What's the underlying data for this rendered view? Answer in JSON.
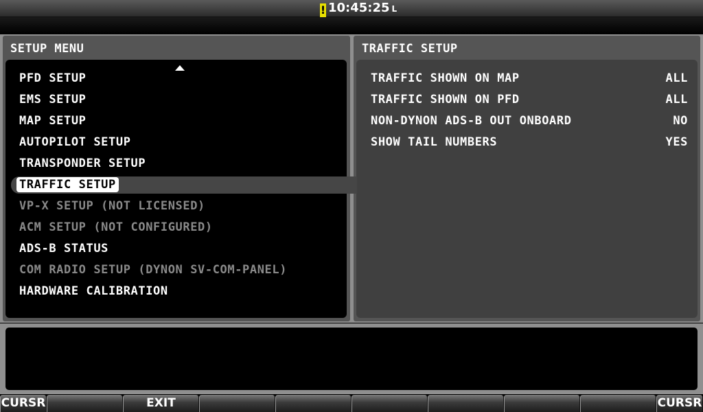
{
  "status": {
    "clock": "10:45:25",
    "clock_suffix": "L",
    "alert": "!"
  },
  "setup_menu": {
    "title": "SETUP MENU",
    "items": [
      {
        "label": "PFD SETUP",
        "state": "enabled"
      },
      {
        "label": "EMS SETUP",
        "state": "enabled"
      },
      {
        "label": "MAP SETUP",
        "state": "enabled"
      },
      {
        "label": "AUTOPILOT SETUP",
        "state": "enabled"
      },
      {
        "label": "TRANSPONDER SETUP",
        "state": "enabled"
      },
      {
        "label": "TRAFFIC SETUP",
        "state": "selected"
      },
      {
        "label": "VP-X SETUP (NOT LICENSED)",
        "state": "disabled"
      },
      {
        "label": "ACM SETUP (NOT CONFIGURED)",
        "state": "disabled"
      },
      {
        "label": "ADS-B STATUS",
        "state": "enabled"
      },
      {
        "label": "COM RADIO SETUP (DYNON SV-COM-PANEL)",
        "state": "disabled"
      },
      {
        "label": "HARDWARE CALIBRATION",
        "state": "enabled"
      }
    ]
  },
  "traffic_setup": {
    "title": "TRAFFIC SETUP",
    "rows": [
      {
        "label": "TRAFFIC SHOWN ON MAP",
        "value": "ALL"
      },
      {
        "label": "TRAFFIC SHOWN ON PFD",
        "value": "ALL"
      },
      {
        "label": "NON-DYNON ADS-B OUT ONBOARD",
        "value": "NO"
      },
      {
        "label": "SHOW TAIL NUMBERS",
        "value": "YES"
      }
    ]
  },
  "softkeys": [
    "CURSR",
    "",
    "EXIT",
    "",
    "",
    "",
    "",
    "",
    "CURSR"
  ],
  "colors": {
    "alert": "#e8e000",
    "disabled_text": "#8a8a8a",
    "selected_bg": "#ffffff",
    "frame": "#8f8f8f"
  }
}
